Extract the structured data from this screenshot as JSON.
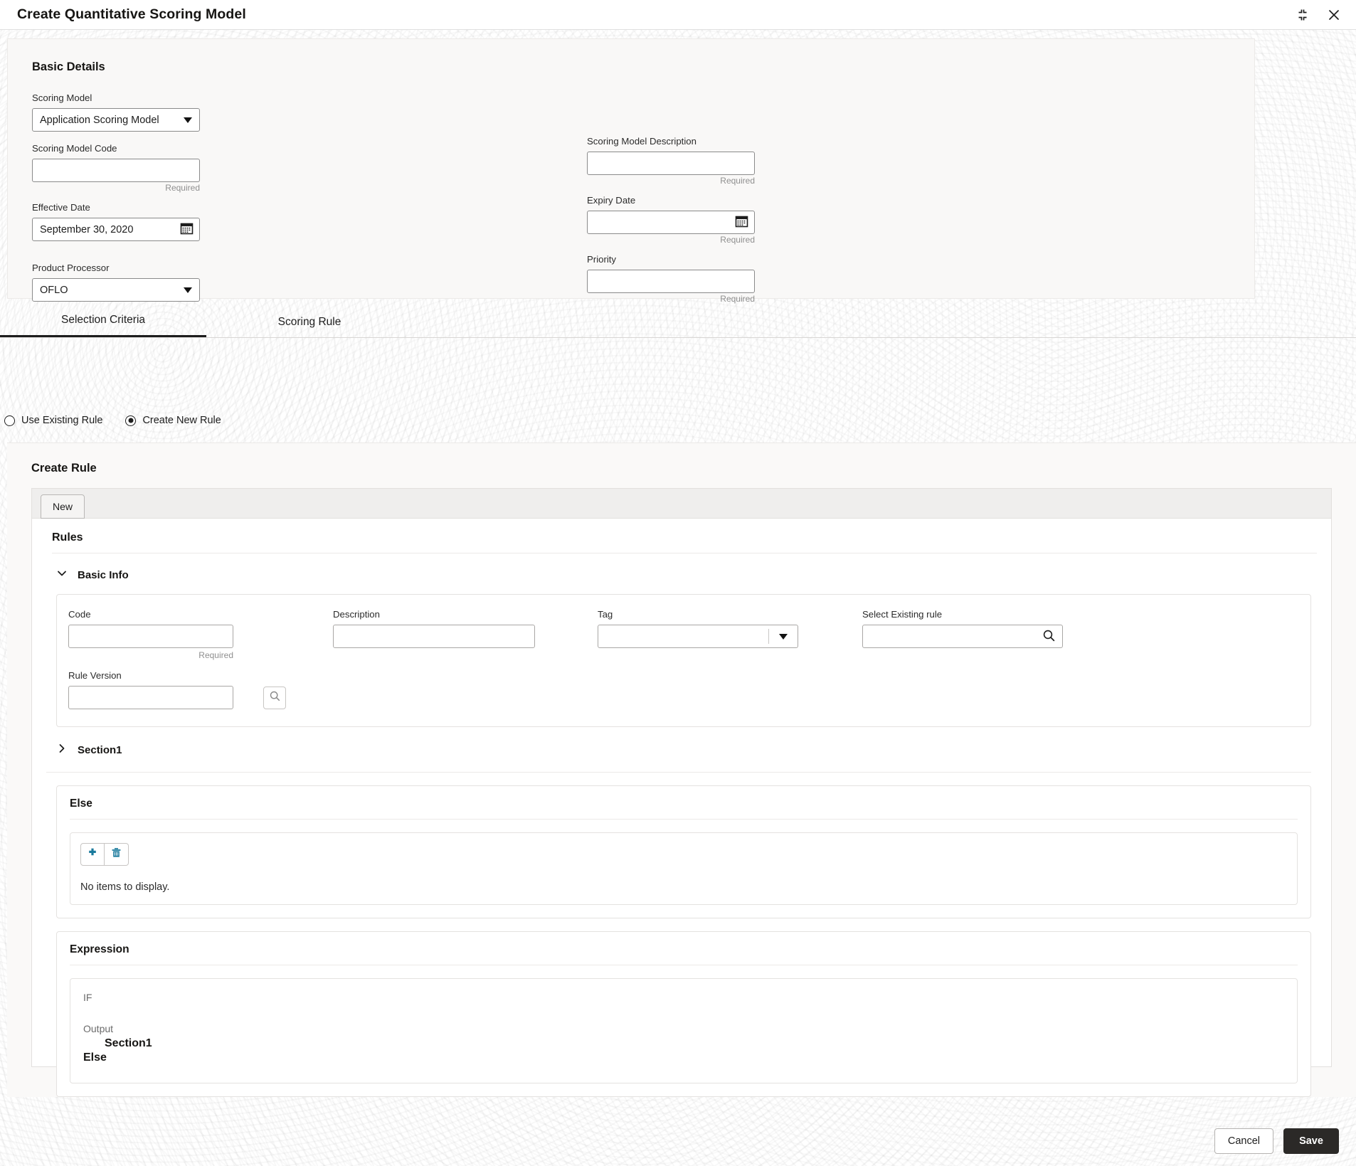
{
  "window": {
    "title": "Create Quantitative Scoring Model",
    "minimize_icon": "collapse-corners-icon",
    "close_icon": "close-icon"
  },
  "basic_details": {
    "heading": "Basic Details",
    "fields": {
      "scoring_model": {
        "label": "Scoring Model",
        "value": "Application Scoring Model",
        "type": "select",
        "icon": "chevron-down-icon"
      },
      "scoring_model_code": {
        "label": "Scoring Model Code",
        "value": "",
        "placeholder": "",
        "hint": "Required"
      },
      "scoring_model_description": {
        "label": "Scoring Model Description",
        "value": "",
        "placeholder": "",
        "hint": "Required"
      },
      "effective_date": {
        "label": "Effective Date",
        "value": "September 30, 2020",
        "icon": "calendar-icon"
      },
      "expiry_date": {
        "label": "Expiry Date",
        "value": "",
        "hint": "Required",
        "icon": "calendar-icon"
      },
      "product_processor": {
        "label": "Product Processor",
        "value": "OFLO",
        "type": "select",
        "icon": "chevron-down-icon"
      },
      "priority": {
        "label": "Priority",
        "value": "",
        "hint": "Required"
      }
    }
  },
  "tabs": [
    {
      "label": "Selection Criteria",
      "selected": true
    },
    {
      "label": "Scoring Rule",
      "selected": false
    }
  ],
  "rule_mode": {
    "options": [
      {
        "label": "Use Existing Rule",
        "selected": false
      },
      {
        "label": "Create New Rule",
        "selected": true
      }
    ]
  },
  "create_rule": {
    "heading": "Create Rule",
    "new_tab_label": "New",
    "rules_heading": "Rules",
    "basic_info": {
      "label": "Basic Info",
      "expanded": true,
      "chevron": "chevron-down-icon",
      "code": {
        "label": "Code",
        "value": "",
        "hint": "Required"
      },
      "description": {
        "label": "Description",
        "value": ""
      },
      "tag": {
        "label": "Tag",
        "value": "",
        "icon": "chevron-down-icon"
      },
      "select_existing_rule": {
        "label": "Select Existing rule",
        "value": "",
        "icon": "search-icon"
      },
      "rule_version": {
        "label": "Rule Version",
        "value": ""
      },
      "rule_version_search_icon": "search-icon"
    },
    "section1": {
      "label": "Section1",
      "expanded": false,
      "chevron": "chevron-right-icon"
    },
    "else_block": {
      "title": "Else",
      "add_icon": "plus-icon",
      "delete_icon": "trash-icon",
      "empty_text": "No items to display.",
      "icon_color": "#1a7a9c"
    },
    "expression": {
      "title": "Expression",
      "if_label": "IF",
      "output_label": "Output",
      "output_value": "Section1",
      "else_label": "Else"
    }
  },
  "footer": {
    "cancel_label": "Cancel",
    "save_label": "Save"
  }
}
